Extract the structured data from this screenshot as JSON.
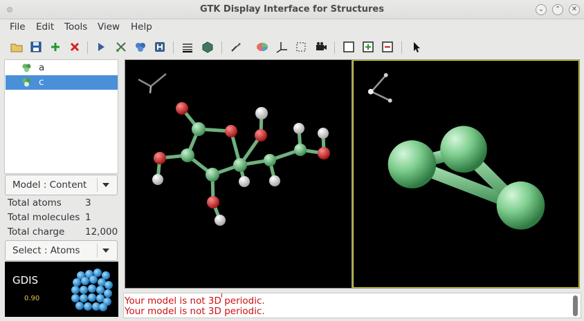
{
  "window": {
    "title": "GTK Display Interface for Structures"
  },
  "menubar": {
    "items": [
      "File",
      "Edit",
      "Tools",
      "View",
      "Help"
    ]
  },
  "toolbar": {
    "buttons": [
      "open-file-icon",
      "save-file-icon",
      "new-model-icon",
      "close-model-icon",
      "animate-icon",
      "edit-structure-icon",
      "periodic-table-icon",
      "hydrogen-icon",
      "measure-icon",
      "build-icon",
      "render-icon",
      "colour-icon",
      "axes-icon",
      "cell-icon",
      "movie-icon",
      "one-pane-icon",
      "add-pane-icon",
      "remove-pane-icon",
      "pointer-icon"
    ]
  },
  "models": [
    {
      "label": "a",
      "selected": false
    },
    {
      "label": "c",
      "selected": true
    }
  ],
  "model_combo": {
    "label": "Model : Content"
  },
  "stats": [
    {
      "label": "Total atoms",
      "value": "3"
    },
    {
      "label": "Total molecules",
      "value": "1"
    },
    {
      "label": "Total charge",
      "value": "12,000"
    }
  ],
  "select_combo": {
    "label": "Select : Atoms"
  },
  "logo": {
    "name": "GDIS",
    "version": "0.90"
  },
  "messages": [
    "Your model is not 3D periodic.",
    "Your model is not 3D periodic."
  ],
  "colors": {
    "carbon": "#5fbf74",
    "oxygen": "#cc2222",
    "hydrogen": "#e6e6e6",
    "selection": "#4a90d9",
    "error_text": "#cc1010",
    "active_pane_border": "#d6d600"
  }
}
